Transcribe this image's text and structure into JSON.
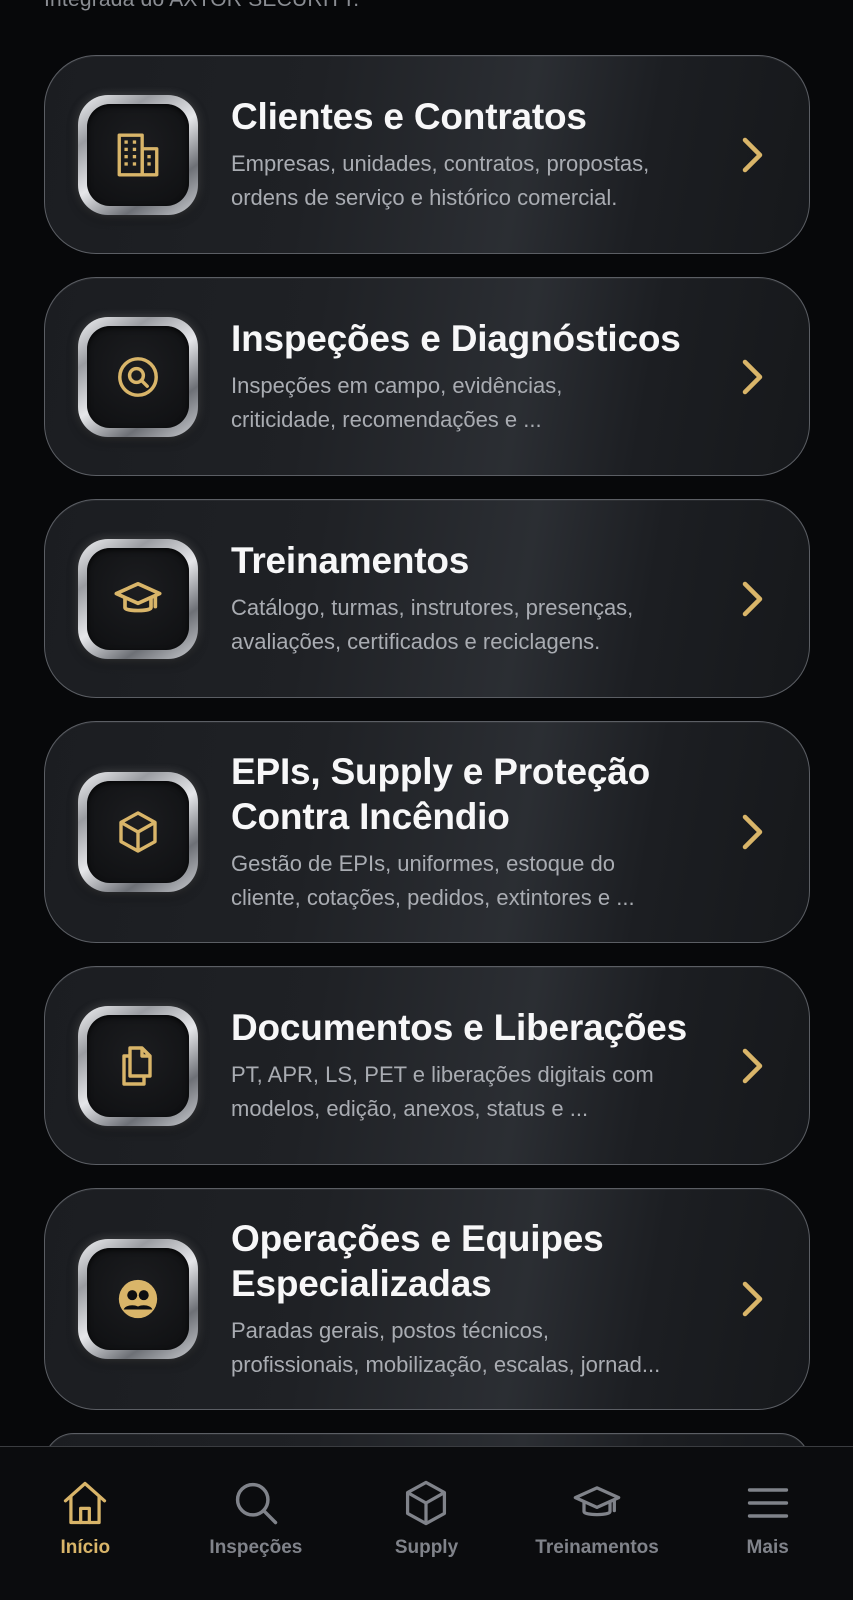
{
  "header": {
    "cut_text": "Integrada do AXTOR SECURITY."
  },
  "modules": [
    {
      "title": "Clientes e Contratos",
      "description": "Empresas, unidades, contratos, propostas,\nordens de serviço e histórico comercial.",
      "icon": "building-icon"
    },
    {
      "title": "Inspeções e Diagnósticos",
      "description": "Inspeções em campo, evidências,\ncriticidade, recomendações e ...",
      "icon": "search-circle-icon"
    },
    {
      "title": "Treinamentos",
      "description": "Catálogo, turmas, instrutores, presenças,\navaliações, certificados e reciclagens.",
      "icon": "graduation-cap-icon"
    },
    {
      "title": "EPIs, Supply e Proteção Contra Incêndio",
      "description": "Gestão de EPIs, uniformes, estoque do\ncliente, cotações, pedidos, extintores e ...",
      "icon": "box-icon"
    },
    {
      "title": "Documentos e Liberações",
      "description": "PT, APR, LS, PET e liberações digitais com\nmodelos, edição, anexos, status e ...",
      "icon": "documents-icon"
    },
    {
      "title": "Operações e Equipes Especializadas",
      "description": "Paradas gerais, postos técnicos,\nprofissionais, mobilização, escalas, jornad...",
      "icon": "team-icon"
    }
  ],
  "tabbar": {
    "items": [
      {
        "label": "Início",
        "icon": "home-icon",
        "active": true
      },
      {
        "label": "Inspeções",
        "icon": "search-icon",
        "active": false
      },
      {
        "label": "Supply",
        "icon": "box-icon",
        "active": false
      },
      {
        "label": "Treinamentos",
        "icon": "graduation-cap-icon",
        "active": false
      },
      {
        "label": "Mais",
        "icon": "menu-icon",
        "active": false
      }
    ]
  },
  "colors": {
    "accent": "#d9b569",
    "background": "#07080a",
    "card_border": "#5b5e64",
    "inactive": "#80838a"
  }
}
